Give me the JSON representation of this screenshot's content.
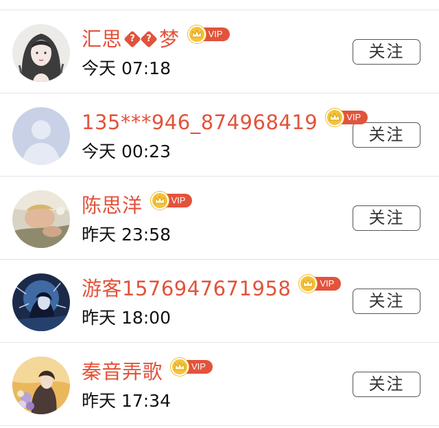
{
  "follow_label": "关注",
  "vip_label": "VIP",
  "rows": [
    {
      "name_pre": "汇思",
      "name_post": "梦",
      "special_glyph": "?",
      "time": "今天 07:18",
      "avatar": "avatar-girl-sketch-icon"
    },
    {
      "name": "135***946_874968419",
      "time": "今天 00:23",
      "avatar": "default-user-icon"
    },
    {
      "name": "陈思洋",
      "time": "昨天 23:58",
      "avatar": "avatar-photo-icon"
    },
    {
      "name": "游客1576947671958",
      "time": "昨天 18:00",
      "avatar": "avatar-anime-blue-icon"
    },
    {
      "name": "秦音弄歌",
      "time": "昨天 17:34",
      "avatar": "avatar-anime-gold-icon"
    }
  ],
  "colors": {
    "name": "#e2533b",
    "vip_tag": "#e2533b",
    "crown": "#f3c33a",
    "divider": "#e4e4e4"
  }
}
